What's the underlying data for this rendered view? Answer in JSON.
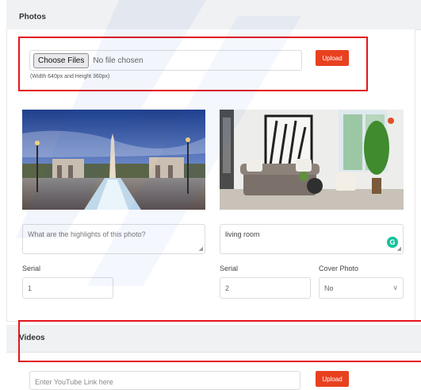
{
  "photos_section": {
    "title": "Photos",
    "choose_files_label": "Choose Files",
    "file_status": "No file chosen",
    "upload_label": "Upload",
    "size_hint": "(Width 640px and Height 360px)",
    "items": [
      {
        "image_icon": "city-plaza-photo",
        "caption_value": "",
        "caption_placeholder": "What are the highlights of this photo?",
        "serial_label": "Serial",
        "serial_value": "1"
      },
      {
        "image_icon": "living-room-photo",
        "caption_value": "living room",
        "caption_placeholder": "",
        "serial_label": "Serial",
        "serial_value": "2",
        "cover_label": "Cover Photo",
        "cover_value": "No",
        "grammarly_icon": "grammarly-icon"
      }
    ]
  },
  "videos_section": {
    "title": "Videos",
    "link_placeholder": "Enter YouTube Link here",
    "upload_label": "Upload"
  },
  "colors": {
    "upload_button": "#e8411f",
    "highlight_box": "#e4141b",
    "grammarly": "#15c39a",
    "header_bg": "#f0f1f3"
  }
}
